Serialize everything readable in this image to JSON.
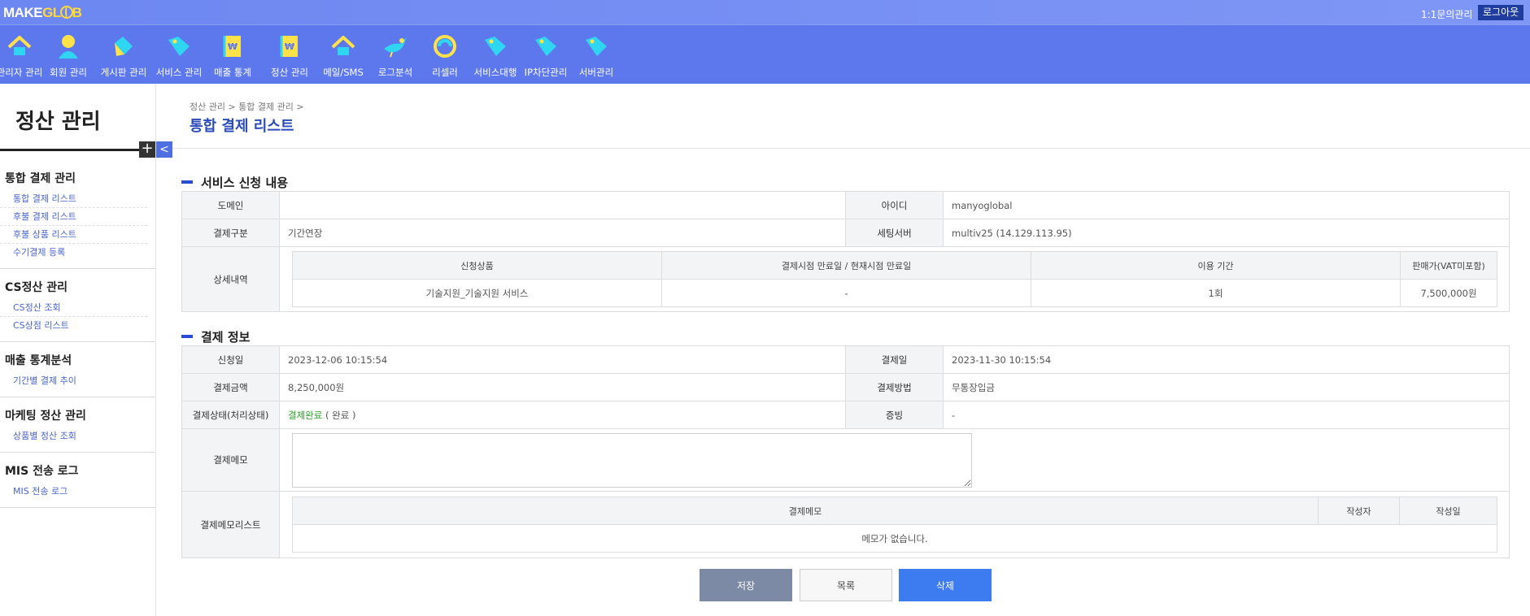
{
  "header": {
    "logo_make": "MAKE",
    "logo_glob_prefix": "GL",
    "logo_glob_suffix": "B",
    "inquiry_link": "1:1문의관리",
    "logout_label": "로그아웃"
  },
  "nav": {
    "items": [
      {
        "label": "관리자 관리",
        "icon": "house-icon"
      },
      {
        "label": "회원 관리",
        "icon": "person-icon"
      },
      {
        "label": "게시판 관리",
        "icon": "diamond-icon"
      },
      {
        "label": "서비스 관리",
        "icon": "tag-icon"
      },
      {
        "label": "매출 통계",
        "icon": "won-notebook-icon"
      },
      {
        "label": "정산 관리",
        "icon": "won-notebook-icon"
      },
      {
        "label": "메일/SMS",
        "icon": "house-icon"
      },
      {
        "label": "로그분석",
        "icon": "bird-icon"
      },
      {
        "label": "리셀러",
        "icon": "refresh-circle-icon"
      },
      {
        "label": "서비스대행",
        "icon": "tag-icon"
      },
      {
        "label": "IP차단관리",
        "icon": "tag-icon"
      },
      {
        "label": "서버관리",
        "icon": "tag-icon"
      }
    ],
    "icon_colors": {
      "yellow": "#ffe24a",
      "cyan": "#2fd6f2"
    }
  },
  "sidebar": {
    "title": "정산 관리",
    "plus": "+",
    "collapse": "<",
    "groups": [
      {
        "title": "통합 결제 관리",
        "items": [
          "통합 결제 리스트",
          "후불 결제 리스트",
          "후불 상품 리스트",
          "수기결제 등록"
        ]
      },
      {
        "title": "CS정산 관리",
        "items": [
          "CS정산 조회",
          "CS상점 리스트"
        ]
      },
      {
        "title": "매출 통계분석",
        "items": [
          "기간별 결제 추이"
        ]
      },
      {
        "title": "마케팅 정산 관리",
        "items": [
          "상품별 정산 조회"
        ]
      },
      {
        "title": "MIS 전송 로그",
        "items": [
          "MIS 전송 로그"
        ]
      }
    ]
  },
  "content": {
    "breadcrumb": "정산 관리 > 통합 결제 관리 >",
    "title": "통합 결제 리스트"
  },
  "service": {
    "section_title": "서비스 신청 내용",
    "domain_label": "도메인",
    "domain_value": "",
    "id_label": "아이디",
    "id_value": "manyoglobal",
    "paytype_label": "결제구분",
    "paytype_value": "기간연장",
    "server_label": "세팅서버",
    "server_value": "multiv25 (14.129.113.95)",
    "detail_label": "상세내역",
    "detail_headers": [
      "신청상품",
      "결제시점 만료일 / 현재시점 만료일",
      "이용 기간",
      "판매가(VAT미포함)"
    ],
    "detail_row": [
      "기술지원_기술지원 서비스",
      "-",
      "1회",
      "7,500,000원"
    ]
  },
  "payment": {
    "section_title": "결제 정보",
    "apply_date_label": "신청일",
    "apply_date_value": "2023-12-06 10:15:54",
    "pay_date_label": "결제일",
    "pay_date_value": "2023-11-30 10:15:54",
    "amount_label": "결제금액",
    "amount_value": "8,250,000원",
    "method_label": "결제방법",
    "method_value": "무통장입금",
    "status_label": "결제상태(처리상태)",
    "status_value": "결제완료",
    "status_process": " ( 완료 )",
    "proof_label": "증빙",
    "proof_value": "-",
    "memo_label": "결제메모",
    "memo_value": "",
    "memo_list_label": "결제메모리스트",
    "memo_list_headers": [
      "결제메모",
      "작성자",
      "작성일"
    ],
    "memo_empty": "메모가 없습니다."
  },
  "buttons": {
    "save": "저장",
    "list": "목록",
    "delete": "삭제"
  }
}
